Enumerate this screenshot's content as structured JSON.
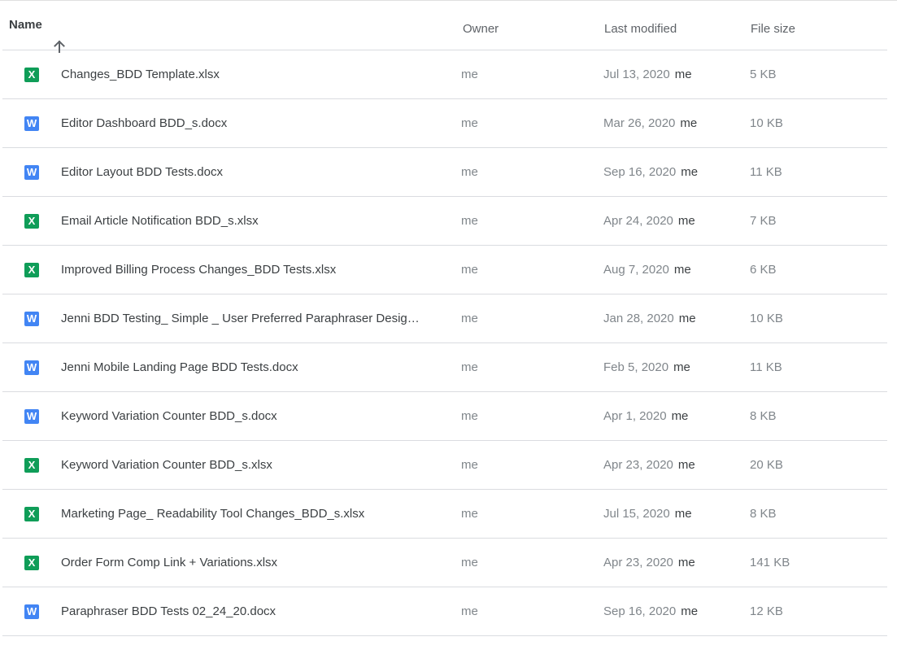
{
  "header": {
    "name": "Name",
    "sort_icon": "arrow-up-icon",
    "owner": "Owner",
    "last_modified": "Last modified",
    "file_size": "File size"
  },
  "colors": {
    "xlsx_icon": "#0f9d58",
    "docx_icon": "#4285f4",
    "divider": "#dadce0"
  },
  "files": [
    {
      "icon_type": "xlsx",
      "icon_letter": "X",
      "name": "Changes_BDD Template.xlsx",
      "owner": "me",
      "modified": "Jul 13, 2020",
      "modified_by": "me",
      "size": "5 KB"
    },
    {
      "icon_type": "docx",
      "icon_letter": "W",
      "name": "Editor Dashboard BDD_s.docx",
      "owner": "me",
      "modified": "Mar 26, 2020",
      "modified_by": "me",
      "size": "10 KB"
    },
    {
      "icon_type": "docx",
      "icon_letter": "W",
      "name": "Editor Layout BDD Tests.docx",
      "owner": "me",
      "modified": "Sep 16, 2020",
      "modified_by": "me",
      "size": "11 KB"
    },
    {
      "icon_type": "xlsx",
      "icon_letter": "X",
      "name": "Email Article Notification BDD_s.xlsx",
      "owner": "me",
      "modified": "Apr 24, 2020",
      "modified_by": "me",
      "size": "7 KB"
    },
    {
      "icon_type": "xlsx",
      "icon_letter": "X",
      "name": "Improved Billing Process Changes_BDD Tests.xlsx",
      "owner": "me",
      "modified": "Aug 7, 2020",
      "modified_by": "me",
      "size": "6 KB"
    },
    {
      "icon_type": "docx",
      "icon_letter": "W",
      "name": "Jenni BDD Testing_ Simple _ User Preferred Paraphraser Desig…",
      "owner": "me",
      "modified": "Jan 28, 2020",
      "modified_by": "me",
      "size": "10 KB"
    },
    {
      "icon_type": "docx",
      "icon_letter": "W",
      "name": "Jenni Mobile Landing Page BDD Tests.docx",
      "owner": "me",
      "modified": "Feb 5, 2020",
      "modified_by": "me",
      "size": "11 KB"
    },
    {
      "icon_type": "docx",
      "icon_letter": "W",
      "name": "Keyword Variation Counter BDD_s.docx",
      "owner": "me",
      "modified": "Apr 1, 2020",
      "modified_by": "me",
      "size": "8 KB"
    },
    {
      "icon_type": "xlsx",
      "icon_letter": "X",
      "name": "Keyword Variation Counter BDD_s.xlsx",
      "owner": "me",
      "modified": "Apr 23, 2020",
      "modified_by": "me",
      "size": "20 KB"
    },
    {
      "icon_type": "xlsx",
      "icon_letter": "X",
      "name": "Marketing Page_ Readability Tool Changes_BDD_s.xlsx",
      "owner": "me",
      "modified": "Jul 15, 2020",
      "modified_by": "me",
      "size": "8 KB"
    },
    {
      "icon_type": "xlsx",
      "icon_letter": "X",
      "name": "Order Form Comp Link + Variations.xlsx",
      "owner": "me",
      "modified": "Apr 23, 2020",
      "modified_by": "me",
      "size": "141 KB"
    },
    {
      "icon_type": "docx",
      "icon_letter": "W",
      "name": "Paraphraser BDD Tests 02_24_20.docx",
      "owner": "me",
      "modified": "Sep 16, 2020",
      "modified_by": "me",
      "size": "12 KB"
    }
  ]
}
